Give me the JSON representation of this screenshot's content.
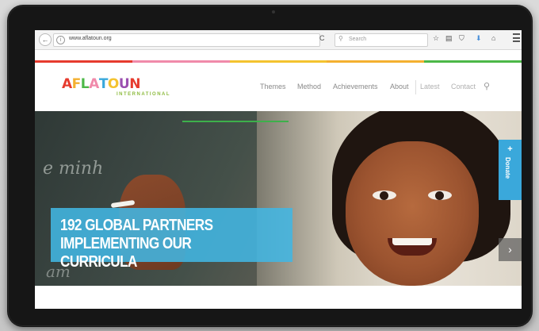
{
  "browser": {
    "url": "www.aflatoun.org",
    "search_placeholder": "Search"
  },
  "colors": {
    "stripe": [
      "#e63b2e",
      "#f08aaa",
      "#f4c32f",
      "#f4b030",
      "#4cb848"
    ],
    "donate": "#3aa8db",
    "headline_bg": "#42b6e2",
    "hero_line": "#3db04b"
  },
  "site": {
    "logo_letters": [
      "A",
      "F",
      "L",
      "A",
      "T",
      "O",
      "U",
      "N"
    ],
    "logo_colors": [
      "#e63b2e",
      "#f4b030",
      "#4cb848",
      "#f08aaa",
      "#3aa8db",
      "#f4c32f",
      "#9b4fb0",
      "#e63b2e"
    ],
    "logo_sub": "INTERNATIONAL",
    "nav": [
      "Themes",
      "Method",
      "Achievements",
      "About",
      "Latest",
      "Contact"
    ]
  },
  "hero": {
    "headline": "192 GLOBAL PARTNERS IMPLEMENTING OUR CURRICULA",
    "donate_label": "Donate",
    "donate_plus": "+",
    "next_label": "›"
  },
  "chalk": {
    "line1": "e minh",
    "line2": "am"
  },
  "icons": {
    "back": "←",
    "info": "i",
    "reload": "C",
    "search": "⚲",
    "bookmark": "☆",
    "reader": "▤",
    "pocket": "⛉",
    "download": "⬇",
    "home": "⌂",
    "nav_search": "⚲"
  }
}
